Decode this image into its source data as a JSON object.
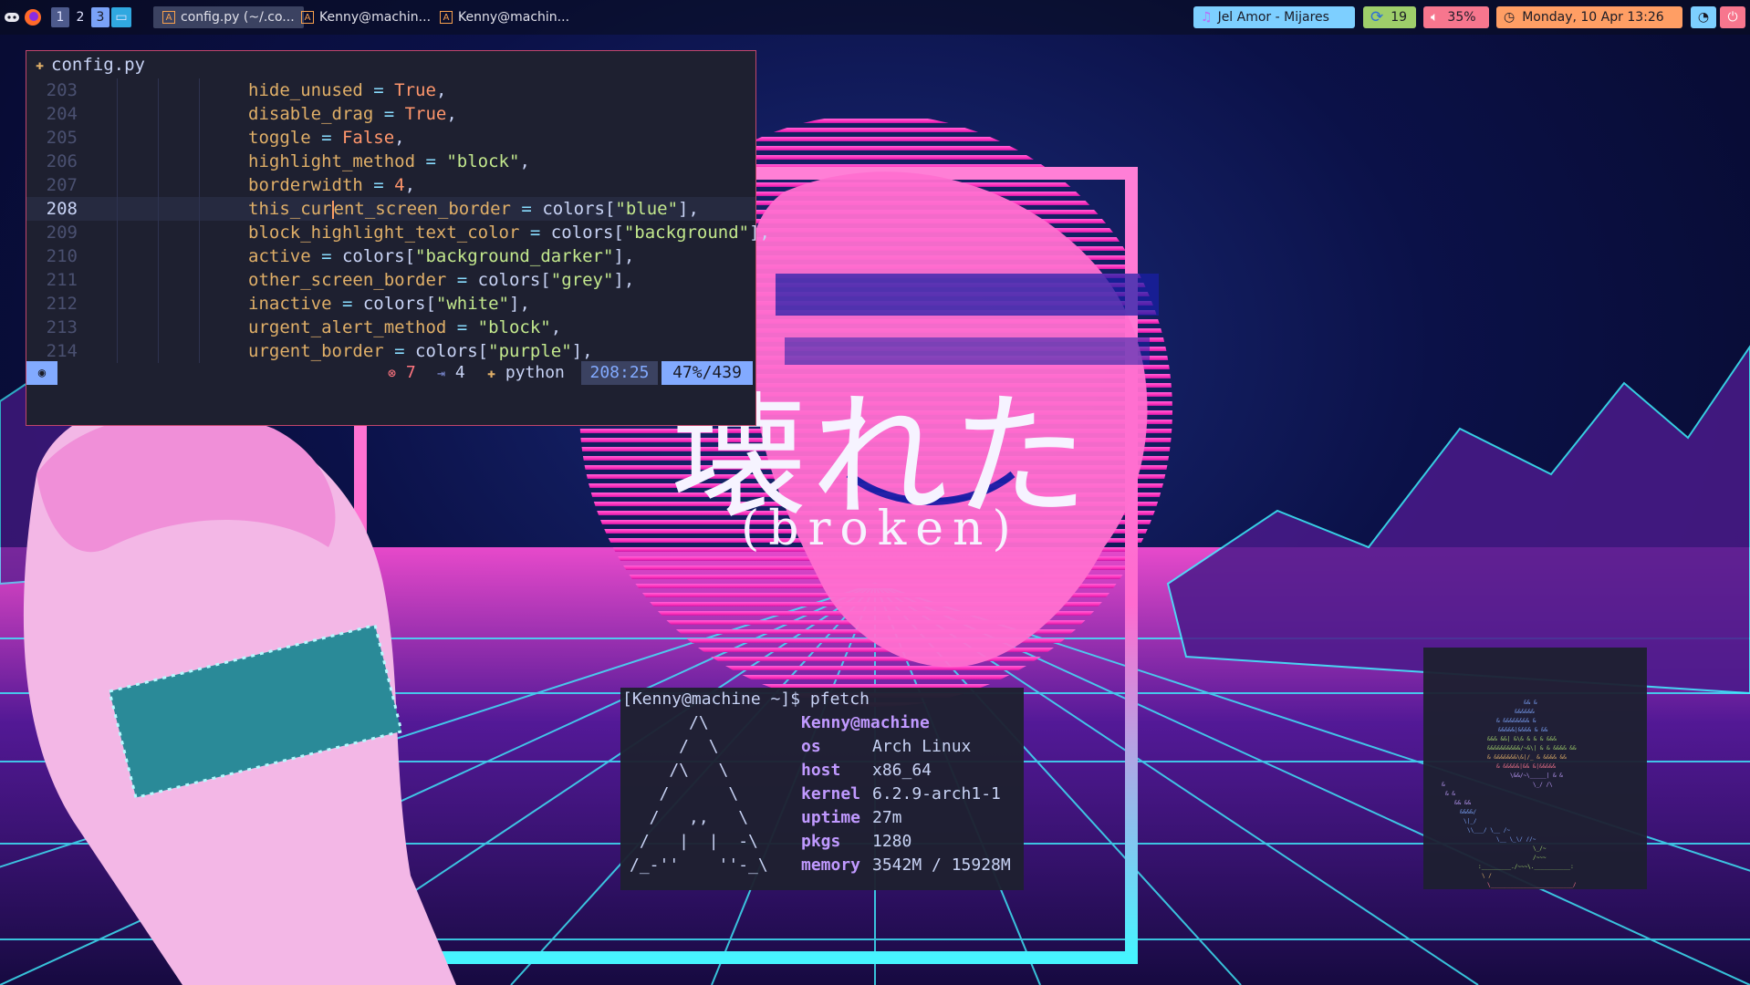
{
  "topbar": {
    "workspaces": [
      "1",
      "2",
      "3"
    ],
    "tasks": [
      {
        "title": "config.py (~/.co..."
      },
      {
        "title": "Kenny@machin..."
      },
      {
        "title": "Kenny@machin..."
      }
    ],
    "widgets": {
      "music": "Jel Amor - Mijares",
      "updates": "19",
      "volume": "35%",
      "clock": "Monday, 10 Apr 13:26"
    }
  },
  "editor": {
    "filename": "config.py",
    "lines": [
      {
        "num": "203",
        "seg": [
          [
            "id",
            "hide_unused"
          ],
          [
            "op",
            " = "
          ],
          [
            "kw",
            "True"
          ],
          [
            "pl",
            ","
          ]
        ]
      },
      {
        "num": "204",
        "seg": [
          [
            "id",
            "disable_drag"
          ],
          [
            "op",
            " = "
          ],
          [
            "kw",
            "True"
          ],
          [
            "pl",
            ","
          ]
        ]
      },
      {
        "num": "205",
        "seg": [
          [
            "id",
            "toggle"
          ],
          [
            "op",
            " = "
          ],
          [
            "kw",
            "False"
          ],
          [
            "pl",
            ","
          ]
        ]
      },
      {
        "num": "206",
        "seg": [
          [
            "id",
            "highlight_method"
          ],
          [
            "op",
            " = "
          ],
          [
            "str",
            "\"block\""
          ],
          [
            "pl",
            ","
          ]
        ]
      },
      {
        "num": "207",
        "seg": [
          [
            "id",
            "borderwidth"
          ],
          [
            "op",
            " = "
          ],
          [
            "kw",
            "4"
          ],
          [
            "pl",
            ","
          ]
        ]
      },
      {
        "num": "208",
        "seg": [
          [
            "id",
            "this_cur"
          ],
          [
            "cursor",
            ""
          ],
          [
            "id",
            "ent_screen_border"
          ],
          [
            "op",
            " = "
          ],
          [
            "pl",
            "colors["
          ],
          [
            "str",
            "\"blue\""
          ],
          [
            "pl",
            "],"
          ]
        ]
      },
      {
        "num": "209",
        "seg": [
          [
            "id",
            "block_highlight_text_color"
          ],
          [
            "op",
            " = "
          ],
          [
            "pl",
            "colors["
          ],
          [
            "str",
            "\"background\""
          ],
          [
            "pl",
            "],"
          ]
        ]
      },
      {
        "num": "210",
        "seg": [
          [
            "id",
            "active"
          ],
          [
            "op",
            " = "
          ],
          [
            "pl",
            "colors["
          ],
          [
            "str",
            "\"background_darker\""
          ],
          [
            "pl",
            "],"
          ]
        ]
      },
      {
        "num": "211",
        "seg": [
          [
            "id",
            "other_screen_border"
          ],
          [
            "op",
            " = "
          ],
          [
            "pl",
            "colors["
          ],
          [
            "str",
            "\"grey\""
          ],
          [
            "pl",
            "],"
          ]
        ]
      },
      {
        "num": "212",
        "seg": [
          [
            "id",
            "inactive"
          ],
          [
            "op",
            " = "
          ],
          [
            "pl",
            "colors["
          ],
          [
            "str",
            "\"white\""
          ],
          [
            "pl",
            "],"
          ]
        ]
      },
      {
        "num": "213",
        "seg": [
          [
            "id",
            "urgent_alert_method"
          ],
          [
            "op",
            " = "
          ],
          [
            "str",
            "\"block\""
          ],
          [
            "pl",
            ","
          ]
        ]
      },
      {
        "num": "214",
        "seg": [
          [
            "id",
            "urgent_border"
          ],
          [
            "op",
            " = "
          ],
          [
            "pl",
            "colors["
          ],
          [
            "str",
            "\"purple\""
          ],
          [
            "pl",
            "],"
          ]
        ]
      }
    ],
    "status": {
      "errors": "7",
      "indent": "4",
      "filetype": "python",
      "position": "208:25",
      "percent": "47%/439"
    }
  },
  "wallpaper": {
    "title": "壊れた",
    "subtitle": "(broken)"
  },
  "terminal": {
    "prompt": "[Kenny@machine ~]$ pfetch",
    "logo": [
      "      /\\",
      "     /  \\",
      "    /\\   \\",
      "   /      \\",
      "  /   ,,   \\",
      " /   |  |  -\\",
      "/_-''    ''-_\\"
    ],
    "user": "Kenny@machine",
    "info": [
      {
        "label": "os",
        "value": "Arch Linux"
      },
      {
        "label": "host",
        "value": "x86_64"
      },
      {
        "label": "kernel",
        "value": "6.2.9-arch1-1"
      },
      {
        "label": "uptime",
        "value": "27m"
      },
      {
        "label": "pkgs",
        "value": "1280"
      },
      {
        "label": "memory",
        "value": "3542M / 15928M"
      }
    ]
  },
  "colors": {
    "editor_bg": "#1e2030",
    "status_blue": "#82aaff",
    "status_slate": "#3b4261",
    "music_bg": "#7dcfff",
    "updates_bg": "#9ece6a",
    "volume_bg": "#f7768e",
    "clock_bg": "#ff9e64",
    "power_bg": "#f7768e"
  }
}
